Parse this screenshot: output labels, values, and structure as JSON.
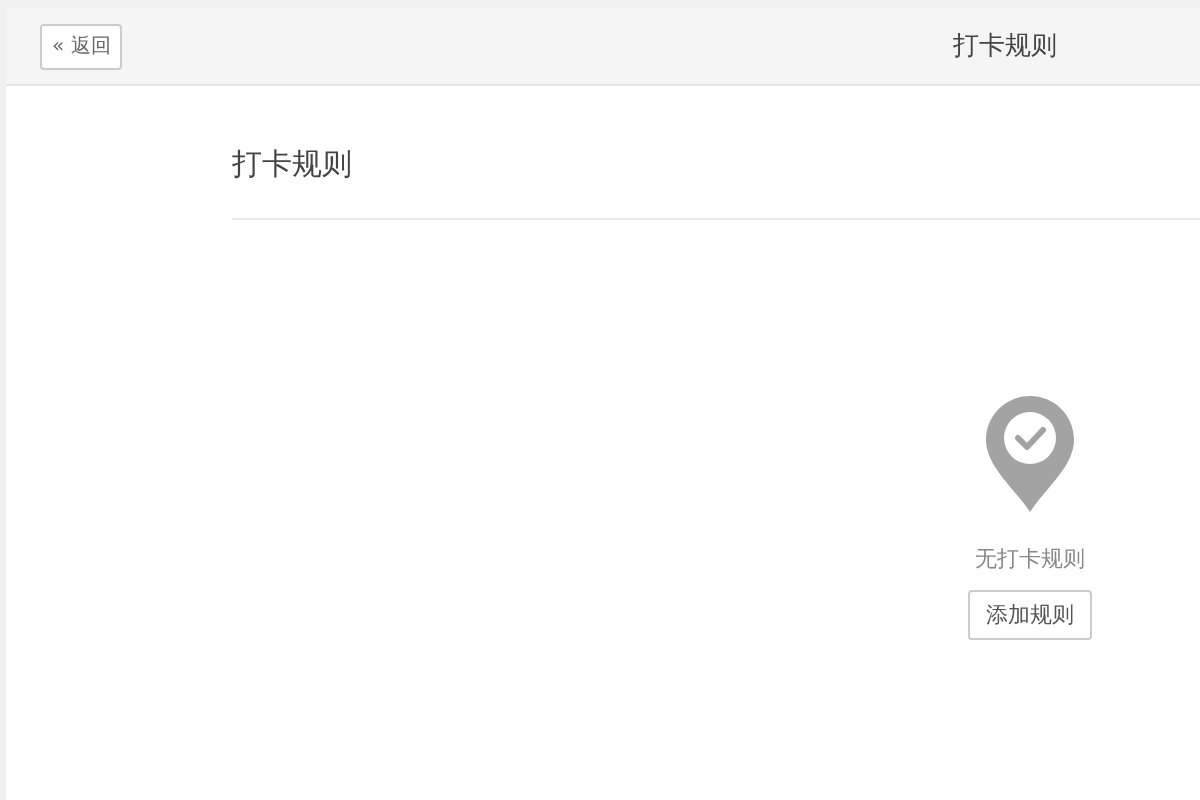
{
  "header": {
    "back_button": "« 返回",
    "title": "打卡规则"
  },
  "section": {
    "title": "打卡规则"
  },
  "empty_state": {
    "message": "无打卡规则",
    "button": "添加规则"
  }
}
